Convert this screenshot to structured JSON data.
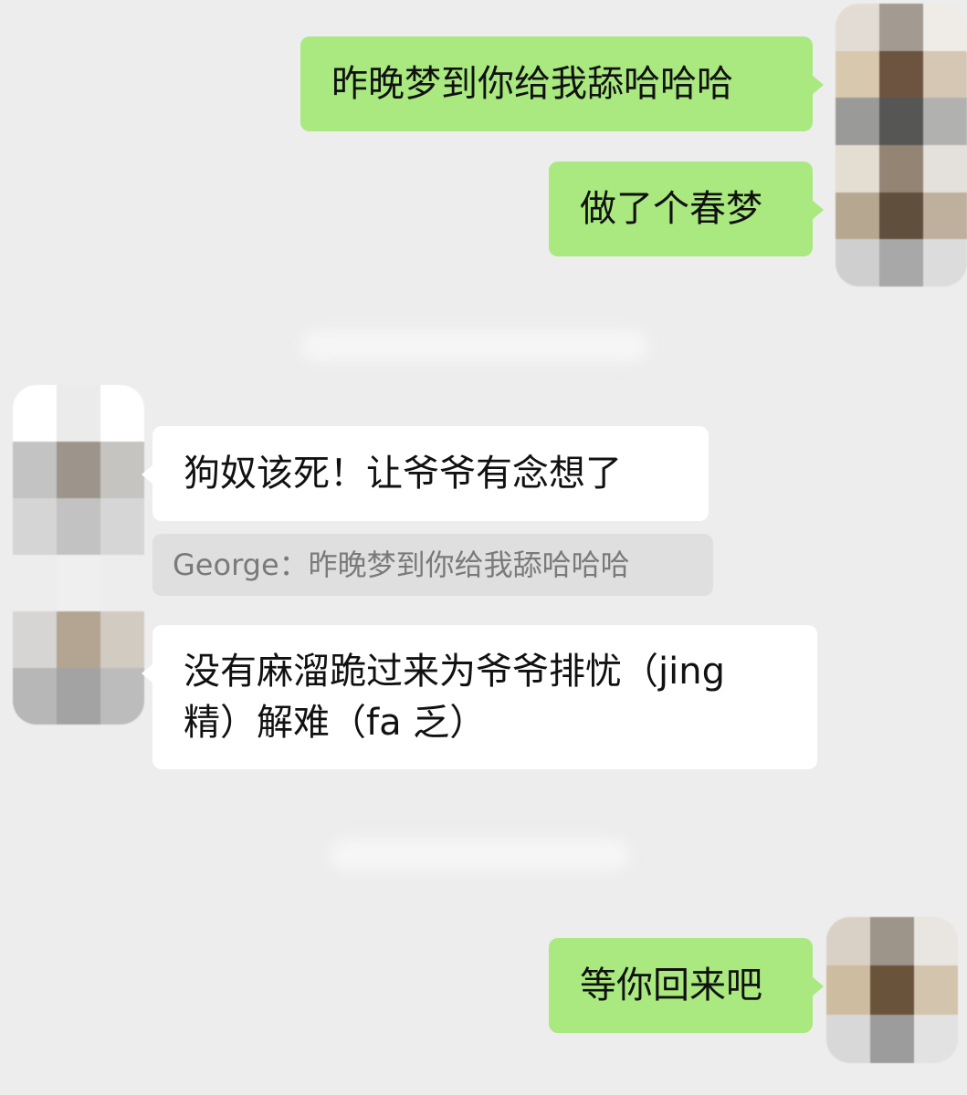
{
  "messages": [
    {
      "side": "out",
      "text": "昨晚梦到你给我舔哈哈哈"
    },
    {
      "side": "out",
      "text": "做了个春梦"
    },
    {
      "side": "in",
      "text": "狗奴该死！让爷爷有念想了"
    },
    {
      "side": "in",
      "quote": "George：昨晚梦到你给我舔哈哈哈"
    },
    {
      "side": "in",
      "line1": "没有麻溜跪过来为爷爷排忧（jing",
      "line2": "精）解难（fa 乏）"
    },
    {
      "side": "out",
      "text": "等你回来吧"
    }
  ],
  "colors": {
    "background": "#ededed",
    "outgoing_bubble": "#a9e97f",
    "incoming_bubble": "#ffffff",
    "quote_bubble": "#dfdfdf"
  },
  "avatars": {
    "self": [
      "#e2dcd5",
      "#a39a91",
      "#efebe7",
      "#d8c9ae",
      "#6c5440",
      "#d6c7b4",
      "#9a9a98",
      "#565655",
      "#b1b1af",
      "#e3ddd2",
      "#938474",
      "#e4e0dc",
      "#b6a790",
      "#604f3c",
      "#bfb09d",
      "#cfcfcf",
      "#a8a8a8",
      "#dcdcdc"
    ],
    "other": [
      "#ffffff",
      "#ebebeb",
      "#ffffff",
      "#c3c3c3",
      "#9d958b",
      "#c6c4c1",
      "#d5d5d5",
      "#c2c2c2",
      "#d6d6d6",
      "#ededed",
      "#efefef",
      "#ededed",
      "#d6d5d3",
      "#b3a592",
      "#d2cbc1",
      "#b7b7b7",
      "#a3a3a3",
      "#bcbcbc"
    ],
    "self_bottom": [
      "#d9d1c5",
      "#9d948a",
      "#e9e5e0",
      "#cdbca0",
      "#6a533b",
      "#d3c4ad",
      "#d8d8d8",
      "#9c9c9c",
      "#e2e2e2"
    ]
  }
}
